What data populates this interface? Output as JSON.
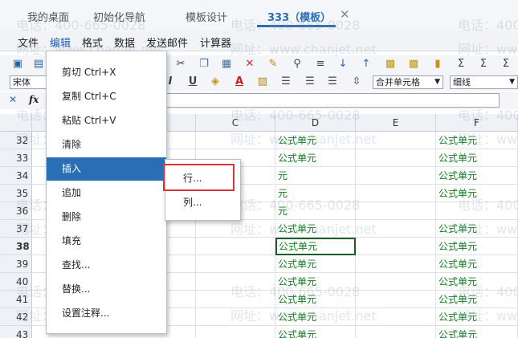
{
  "tabs": [
    {
      "label": "我的桌面"
    },
    {
      "label": "初始化导航"
    },
    {
      "label": "模板设计"
    },
    {
      "label": "333（模板）",
      "active": true
    }
  ],
  "menubar": [
    "文件",
    "编辑",
    "格式",
    "数据",
    "发送邮件",
    "计算器"
  ],
  "format_toolbar": {
    "font": "宋体",
    "merge": "合并单元格",
    "border": "细线"
  },
  "formula": {
    "fx": "fx"
  },
  "columns": [
    "C",
    "D",
    "E",
    "F"
  ],
  "rows": [
    "32",
    "33",
    "34",
    "35",
    "36",
    "37",
    "38",
    "39",
    "40",
    "41",
    "42",
    "43"
  ],
  "selected_row": "38",
  "cells": {
    "D": [
      "公式单元",
      "公式单元",
      "元",
      "元",
      "元",
      "公式单元",
      "公式单元",
      "公式单元",
      "公式单元",
      "公式单元",
      "公式单元",
      "公式单元"
    ],
    "F": [
      "公式单元",
      "公式单元",
      "公式单元",
      "公式单元",
      "",
      "公式单元",
      "公式单元",
      "公式单元",
      "公式单元",
      "公式单元",
      "公式单元",
      "公式单元"
    ]
  },
  "context_menu": {
    "items": [
      "剪切 Ctrl+X",
      "复制 Ctrl+C",
      "粘贴 Ctrl+V",
      "清除",
      "插入",
      "追加",
      "删除",
      "填充",
      "查找...",
      "替换...",
      "设置注释..."
    ],
    "highlighted": "插入"
  },
  "submenu": {
    "items": [
      "行...",
      "列..."
    ]
  },
  "watermark": {
    "phone": "电话：400-665-0028",
    "site": "网址：www.chanjet.net"
  },
  "colors": {
    "accent": "#2a6fb5",
    "formula_text": "#0f7d21",
    "highlight_box": "#d9343a"
  }
}
